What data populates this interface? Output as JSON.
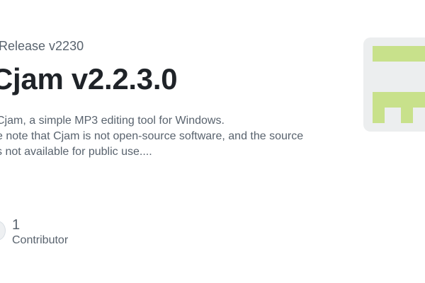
{
  "release": {
    "eyebrow": "Release v2230",
    "title": "Cjam v2.2.3.0",
    "description_lines": [
      "Cjam, a simple MP3 editing tool for Windows.",
      "e note that Cjam is not open-source software, and the source",
      "s not available for public use...."
    ]
  },
  "stats": {
    "contributors_value": "1",
    "contributors_label": "Contributor"
  },
  "colors": {
    "accent_green": "#c8e18b",
    "image_background": "#eceeef",
    "title_text": "#1f2328",
    "muted_text": "#59636e"
  },
  "icons": {
    "repo_image": "identicon-graphic",
    "contributor_avatar": "avatar-icon"
  }
}
